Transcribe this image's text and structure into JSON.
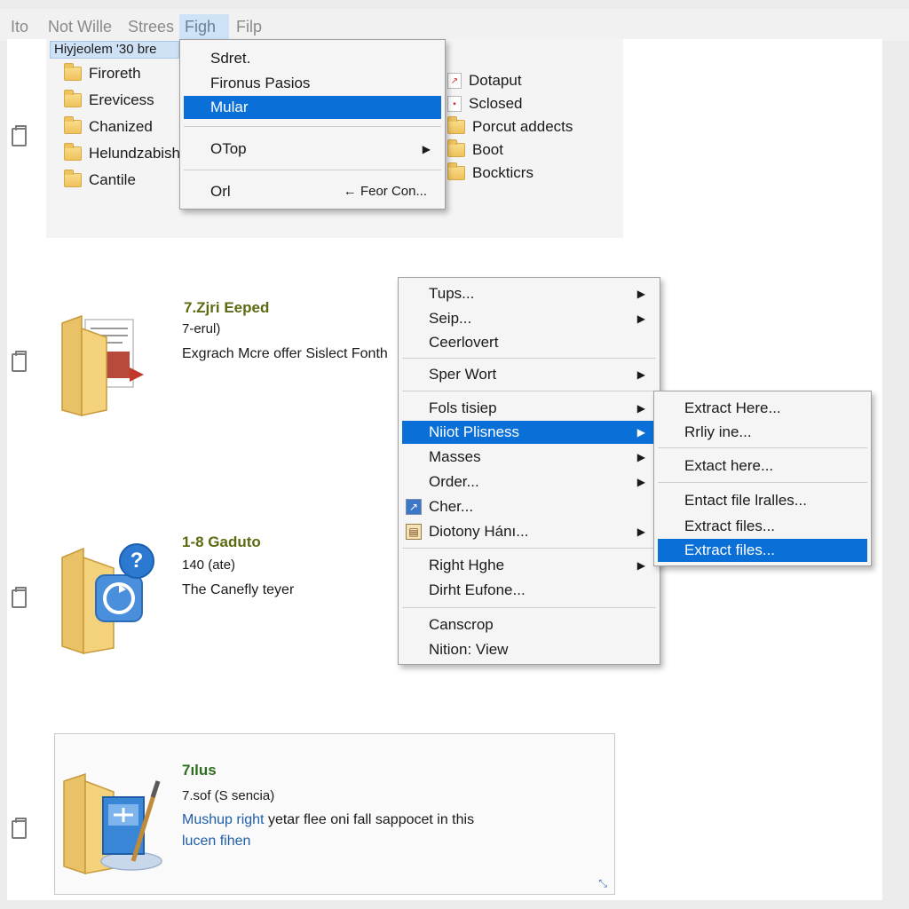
{
  "menubar": {
    "items": [
      {
        "label": "Ito"
      },
      {
        "label": "Not Wille"
      },
      {
        "label": "Strees"
      },
      {
        "label": "Figh",
        "active": true
      },
      {
        "label": "Filp"
      }
    ]
  },
  "explorer": {
    "header": "Hiyjeolem '30 bre",
    "left_folders": [
      "Firoreth",
      "Erevicess",
      "Chanized",
      "Helundzabish",
      "Cantile"
    ],
    "right_items": [
      "Dotaput",
      "Sclosed",
      "Porcut addects",
      "Boot",
      "Bockticrs"
    ]
  },
  "top_menu": {
    "items": [
      {
        "label": "Sdret."
      },
      {
        "label": "Fironus Pasios"
      },
      {
        "label": "Mular",
        "selected": true
      },
      {
        "label": "OTop",
        "arrow": "▶"
      },
      {
        "label": "Orl",
        "shortcut": "← Feor Con..."
      }
    ]
  },
  "results": [
    {
      "title": "7.Zjri Eeped",
      "sub": "7-erul)",
      "desc": "Exgrach Mcre offer Sislect Fonth"
    },
    {
      "title": "1-8 Gaduto",
      "sub": "140 (ate)",
      "desc": "The Canefly teyer"
    },
    {
      "title": "7ılus",
      "sub": "7.sof (S sencia)",
      "desc_link": "Mushup right",
      "desc_rest": " yetar flee oni fall sappocet in this",
      "desc_line2": "lucen fihen"
    }
  ],
  "context_menu": {
    "items": [
      {
        "label": "Tups...",
        "arrow": "▶"
      },
      {
        "label": "Seip...",
        "arrow": "▶"
      },
      {
        "label": "Ceerlovert"
      },
      {
        "label": "Sper Wort",
        "arrow": "▶"
      },
      {
        "label": "Fols tisiep",
        "arrow": "▶"
      },
      {
        "label": "Niiot Plisness",
        "arrow": "▶",
        "selected": true
      },
      {
        "label": "Masses",
        "arrow": "▶"
      },
      {
        "label": "Order...",
        "arrow": "▶"
      },
      {
        "label": "Cher...",
        "icon": "↗"
      },
      {
        "label": "Diotony Hánı...",
        "arrow": "▶",
        "icon": "▤"
      },
      {
        "label": "Right Hghe",
        "arrow": "▶"
      },
      {
        "label": "Dirht Eufone..."
      },
      {
        "label": "Canscrop"
      },
      {
        "label": "Nition: View"
      }
    ]
  },
  "submenu": {
    "items": [
      {
        "label": "Extract Here..."
      },
      {
        "label": "Rrliy ine..."
      },
      {
        "label": "Extact here..."
      },
      {
        "label": "Entact file lralles..."
      },
      {
        "label": "Extract files..."
      },
      {
        "label": "Extract files...",
        "selected": true
      }
    ]
  },
  "icons": {
    "badge_question": "?",
    "card_corner": "⤡"
  },
  "colors": {
    "selection": "#0a6fd6",
    "title_olive": "#5e6a12",
    "link_blue": "#1f5ea8"
  }
}
